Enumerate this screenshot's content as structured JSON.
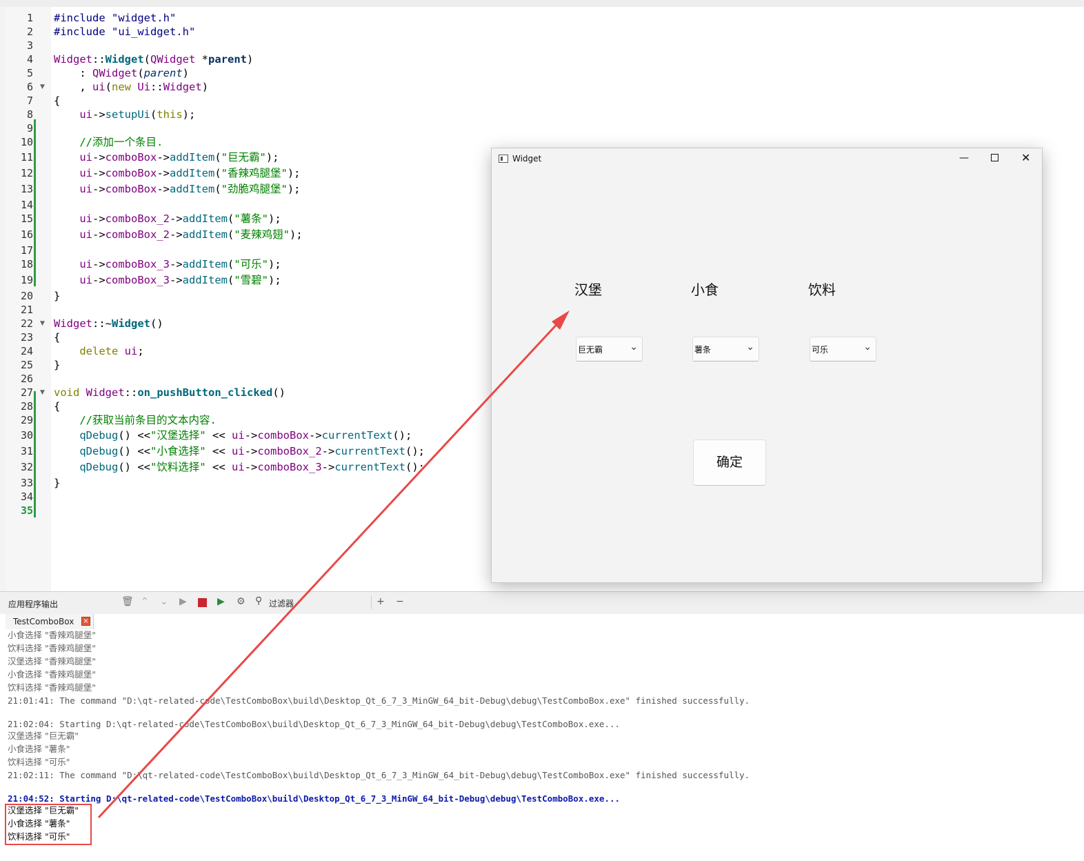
{
  "editor": {
    "line_numbers": [
      "1",
      "2",
      "3",
      "4",
      "5",
      "6",
      "7",
      "8",
      "9",
      "10",
      "11",
      "12",
      "13",
      "14",
      "15",
      "16",
      "17",
      "18",
      "19",
      "20",
      "21",
      "22",
      "23",
      "24",
      "25",
      "26",
      "27",
      "28",
      "29",
      "30",
      "31",
      "32",
      "33",
      "34",
      "35"
    ],
    "include1": "#include \"widget.h\"",
    "include2": "#include \"ui_widget.h\"",
    "comment_add": "//添加一个条目.",
    "item1": "\"巨无霸\"",
    "item2": "\"香辣鸡腿堡\"",
    "item3": "\"劲脆鸡腿堡\"",
    "item4": "\"薯条\"",
    "item5": "\"麦辣鸡翅\"",
    "item6": "\"可乐\"",
    "item7": "\"雪碧\"",
    "comment_get": "//获取当前条目的文本内容.",
    "str_burger": "\"汉堡选择\"",
    "str_snack": "\"小食选择\"",
    "str_drink": "\"饮料选择\""
  },
  "output_panel": {
    "title": "应用程序输出",
    "filter_label": "过滤器",
    "tab_label": "TestComboBox",
    "lines": [
      "小食选择 \"香辣鸡腿堡\"",
      "饮料选择 \"香辣鸡腿堡\"",
      "汉堡选择 \"香辣鸡腿堡\"",
      "小食选择 \"香辣鸡腿堡\"",
      "饮料选择 \"香辣鸡腿堡\""
    ],
    "finished1": "21:01:41: The command \"D:\\qt-related-code\\TestComboBox\\build\\Desktop_Qt_6_7_3_MinGW_64_bit-Debug\\debug\\TestComboBox.exe\" finished successfully.",
    "starting2": "21:02:04: Starting D:\\qt-related-code\\TestComboBox\\build\\Desktop_Qt_6_7_3_MinGW_64_bit-Debug\\debug\\TestComboBox.exe...",
    "run2": [
      "汉堡选择 \"巨无霸\"",
      "小食选择 \"薯条\"",
      "饮料选择 \"可乐\""
    ],
    "finished2": "21:02:11: The command \"D:\\qt-related-code\\TestComboBox\\build\\Desktop_Qt_6_7_3_MinGW_64_bit-Debug\\debug\\TestComboBox.exe\" finished successfully.",
    "starting3": "21:04:52: Starting D:\\qt-related-code\\TestComboBox\\build\\Desktop_Qt_6_7_3_MinGW_64_bit-Debug\\debug\\TestComboBox.exe...",
    "run3": [
      "汉堡选择 \"巨无霸\"",
      "小食选择 \"薯条\"",
      "饮料选择 \"可乐\""
    ]
  },
  "widget_window": {
    "title": "Widget",
    "label_burger": "汉堡",
    "label_snack": "小食",
    "label_drink": "饮料",
    "combo_burger": "巨无霸",
    "combo_snack": "薯条",
    "combo_drink": "可乐",
    "ok_button": "确定"
  },
  "colors": {
    "annotation": "#e94848",
    "keyword": "#808000",
    "string": "#008000"
  }
}
